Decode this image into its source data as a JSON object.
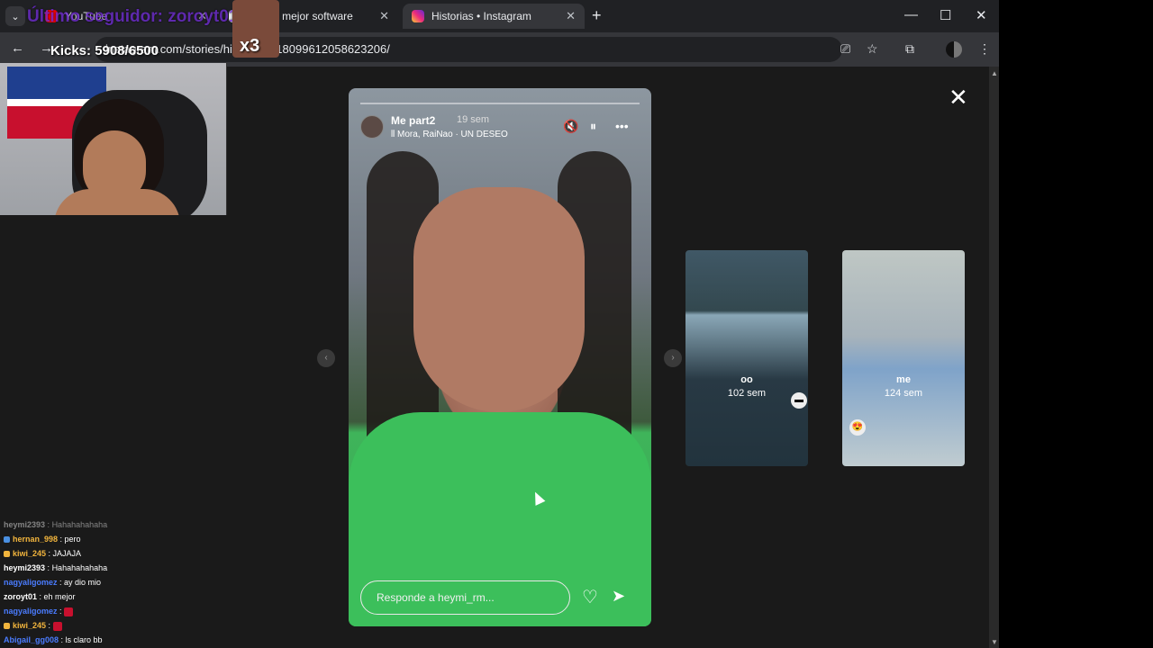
{
  "browser": {
    "tabs": [
      {
        "label": "YouTube",
        "color": "#ff0000"
      },
      {
        "label": "ón | El mejor software",
        "color": "#e8eaed"
      },
      {
        "label": "Historias • Instagram",
        "color": "#e1306c",
        "active": true
      }
    ],
    "url": "instagram.com/stories/highlights/18099612058623206/",
    "icons": {
      "back": "arrow-left-icon",
      "forward": "arrow-right-icon",
      "cast": "cast-icon",
      "star": "star-icon",
      "extensions": "puzzle-icon",
      "menu": "kebab-icon"
    }
  },
  "story": {
    "username": "Me part2",
    "time": "19 sem",
    "music": "Mora, RaiNao · UN DESEO",
    "reply_placeholder": "Responde a heymi_rm...",
    "controls": {
      "mute": "mute-icon",
      "pause": "pause-icon",
      "more": "more-icon"
    }
  },
  "thumbnails": [
    {
      "title": "oo",
      "time": "102 sem"
    },
    {
      "title": "me",
      "time": "124 sem"
    }
  ],
  "overlay": {
    "top_text": "Último seguidor: zoroyt01",
    "kicks": "Kicks: 5908/6500",
    "meme_label": "x3"
  },
  "chat": [
    {
      "user": "heymi2393",
      "msg": "Hahahahahaha",
      "user_color": "#888888",
      "faded": true
    },
    {
      "user": "hernan_998",
      "msg": "pero",
      "user_color": "#f2b53d"
    },
    {
      "user": "kiwi_245",
      "msg": "JAJAJA",
      "user_color": "#f2b53d"
    },
    {
      "user": "heymi2393",
      "msg": "Hahahahahaha",
      "user_color": "#ffffff"
    },
    {
      "user": "nagyaligomez",
      "msg": "ay dio mio",
      "user_color": "#4a7cff"
    },
    {
      "user": "zoroyt01",
      "msg": "eh mejor",
      "user_color": "#ffffff"
    },
    {
      "user": "nagyaligomez",
      "msg": "",
      "user_color": "#4a7cff"
    },
    {
      "user": "kiwi_245",
      "msg": "",
      "user_color": "#f2b53d"
    },
    {
      "user": "Abigail_gg008",
      "msg": "ls claro bb",
      "user_color": "#4a7cff"
    }
  ]
}
